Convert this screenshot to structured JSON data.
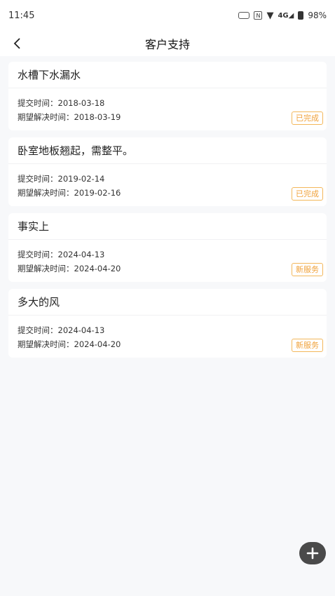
{
  "status_bar": {
    "time": "11:45",
    "battery": "98%",
    "icons": [
      "vibrate-icon",
      "nfc-icon",
      "wifi-icon",
      "signal-4g-icon",
      "battery-icon"
    ]
  },
  "header": {
    "title": "客户支持",
    "back_icon": "chevron-left-icon"
  },
  "tickets": [
    {
      "title": "水槽下水漏水",
      "submit_label": "提交时间：",
      "submit_date": "2018-03-18",
      "expect_label": "期望解决时间：",
      "expect_date": "2018-03-19",
      "status": "已完成"
    },
    {
      "title": "卧室地板翘起，需整平。",
      "submit_label": "提交时间：",
      "submit_date": "2019-02-14",
      "expect_label": "期望解决时间：",
      "expect_date": "2019-02-16",
      "status": "已完成"
    },
    {
      "title": "事实上",
      "submit_label": "提交时间：",
      "submit_date": "2024-04-13",
      "expect_label": "期望解决时间：",
      "expect_date": "2024-04-20",
      "status": "新服务"
    },
    {
      "title": "多大的风",
      "submit_label": "提交时间：",
      "submit_date": "2024-04-13",
      "expect_label": "期望解决时间：",
      "expect_date": "2024-04-20",
      "status": "新服务"
    }
  ],
  "fab": {
    "icon": "plus-icon"
  },
  "colors": {
    "accent": "#f0a23b",
    "background": "#f7f8fa",
    "fab": "#4a4a4a"
  }
}
